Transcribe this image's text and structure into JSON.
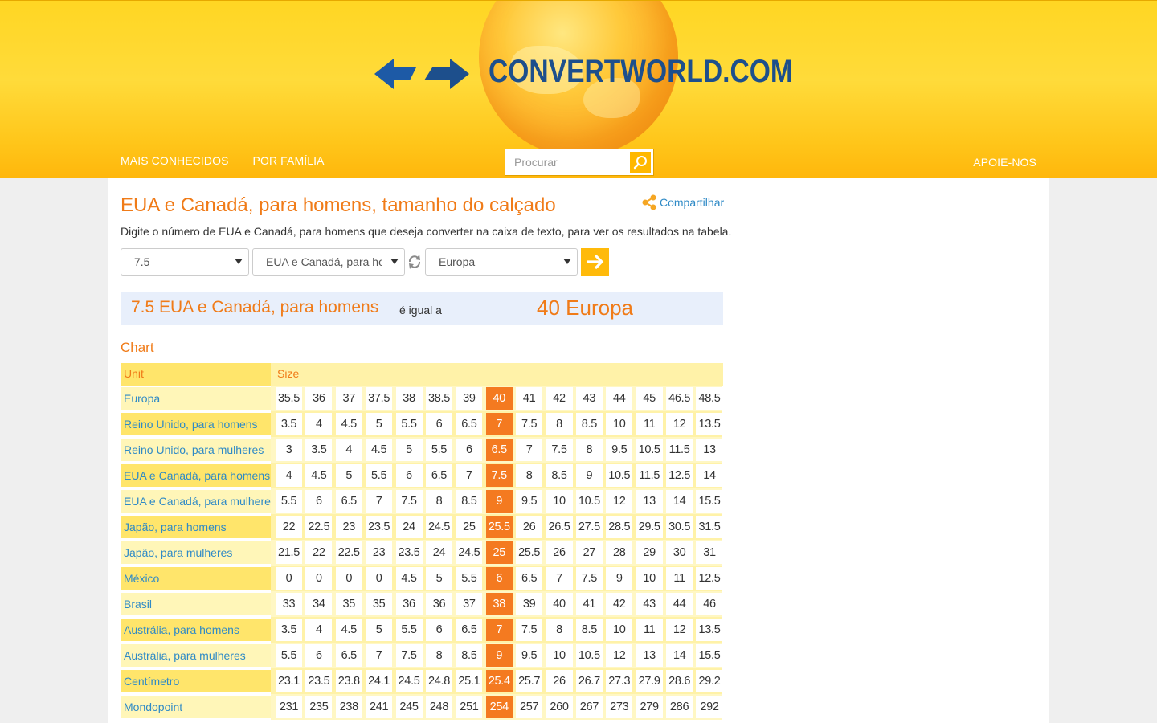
{
  "header": {
    "logo_text": "CONVERTWORLD.COM",
    "nav_left": [
      "MAIS CONHECIDOS",
      "POR FAMÍLIA"
    ],
    "nav_right": "APOIE-NOS",
    "search_placeholder": "Procurar"
  },
  "page": {
    "title": "EUA e Canadá, para homens, tamanho do calçado",
    "share_label": "Compartilhar",
    "description": "Digite o número de EUA e Canadá, para homens que deseja converter na caixa de texto, para ver os resultados na tabela."
  },
  "controls": {
    "value_select": "7.5",
    "from_unit_select": "EUA e Canadá, para homens",
    "to_unit_select": "Europa"
  },
  "result": {
    "from_text": "7.5 EUA e Canadá, para homens",
    "equals_text": "é igual a",
    "to_text": "40 Europa"
  },
  "chart": {
    "label": "Chart",
    "unit_header": "Unit",
    "size_header": "Size",
    "highlight_column": 7,
    "rows": [
      {
        "unit": "Europa",
        "values": [
          "35.5",
          "36",
          "37",
          "37.5",
          "38",
          "38.5",
          "39",
          "40",
          "41",
          "42",
          "43",
          "44",
          "45",
          "46.5",
          "48.5"
        ]
      },
      {
        "unit": "Reino Unido, para homens",
        "values": [
          "3.5",
          "4",
          "4.5",
          "5",
          "5.5",
          "6",
          "6.5",
          "7",
          "7.5",
          "8",
          "8.5",
          "10",
          "11",
          "12",
          "13.5"
        ]
      },
      {
        "unit": "Reino Unido, para mulheres",
        "values": [
          "3",
          "3.5",
          "4",
          "4.5",
          "5",
          "5.5",
          "6",
          "6.5",
          "7",
          "7.5",
          "8",
          "9.5",
          "10.5",
          "11.5",
          "13"
        ]
      },
      {
        "unit": "EUA e Canadá, para homens",
        "values": [
          "4",
          "4.5",
          "5",
          "5.5",
          "6",
          "6.5",
          "7",
          "7.5",
          "8",
          "8.5",
          "9",
          "10.5",
          "11.5",
          "12.5",
          "14"
        ]
      },
      {
        "unit": "EUA e Canadá, para mulheres",
        "values": [
          "5.5",
          "6",
          "6.5",
          "7",
          "7.5",
          "8",
          "8.5",
          "9",
          "9.5",
          "10",
          "10.5",
          "12",
          "13",
          "14",
          "15.5"
        ]
      },
      {
        "unit": "Japão, para homens",
        "values": [
          "22",
          "22.5",
          "23",
          "23.5",
          "24",
          "24.5",
          "25",
          "25.5",
          "26",
          "26.5",
          "27.5",
          "28.5",
          "29.5",
          "30.5",
          "31.5"
        ]
      },
      {
        "unit": "Japão, para mulheres",
        "values": [
          "21.5",
          "22",
          "22.5",
          "23",
          "23.5",
          "24",
          "24.5",
          "25",
          "25.5",
          "26",
          "27",
          "28",
          "29",
          "30",
          "31"
        ]
      },
      {
        "unit": "México",
        "values": [
          "0",
          "0",
          "0",
          "0",
          "4.5",
          "5",
          "5.5",
          "6",
          "6.5",
          "7",
          "7.5",
          "9",
          "10",
          "11",
          "12.5"
        ]
      },
      {
        "unit": "Brasil",
        "values": [
          "33",
          "34",
          "35",
          "35",
          "36",
          "36",
          "37",
          "38",
          "39",
          "40",
          "41",
          "42",
          "43",
          "44",
          "46"
        ]
      },
      {
        "unit": "Austrália, para homens",
        "values": [
          "3.5",
          "4",
          "4.5",
          "5",
          "5.5",
          "6",
          "6.5",
          "7",
          "7.5",
          "8",
          "8.5",
          "10",
          "11",
          "12",
          "13.5"
        ]
      },
      {
        "unit": "Austrália, para mulheres",
        "values": [
          "5.5",
          "6",
          "6.5",
          "7",
          "7.5",
          "8",
          "8.5",
          "9",
          "9.5",
          "10",
          "10.5",
          "12",
          "13",
          "14",
          "15.5"
        ]
      },
      {
        "unit": "Centímetro",
        "values": [
          "23.1",
          "23.5",
          "23.8",
          "24.1",
          "24.5",
          "24.8",
          "25.1",
          "25.4",
          "25.7",
          "26",
          "26.7",
          "27.3",
          "27.9",
          "28.6",
          "29.2"
        ]
      },
      {
        "unit": "Mondopoint",
        "values": [
          "231",
          "235",
          "238",
          "241",
          "245",
          "248",
          "251",
          "254",
          "257",
          "260",
          "267",
          "273",
          "279",
          "286",
          "292"
        ]
      }
    ]
  },
  "colors": {
    "accent_orange": "#f07b18",
    "highlight": "#f47a20",
    "link_blue": "#2f8ac6",
    "logo_blue": "#1d4f8c"
  }
}
